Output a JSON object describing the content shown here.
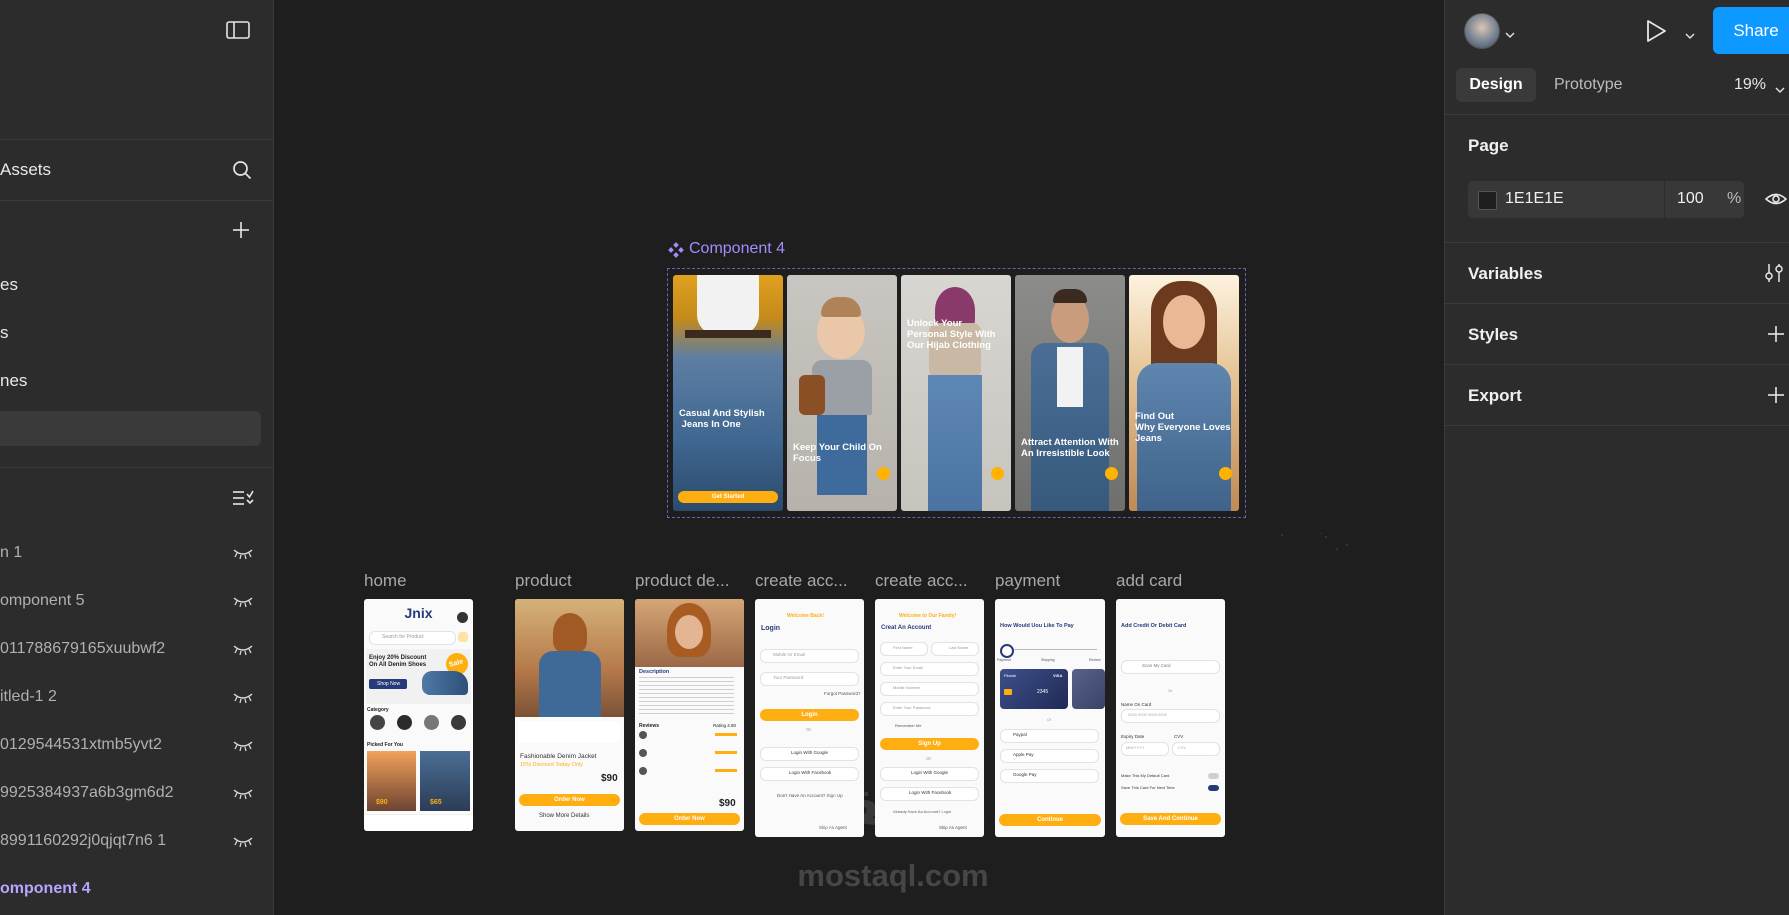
{
  "left_panel": {
    "assets_label": "Assets",
    "pages": [
      "es",
      "s",
      "nes"
    ],
    "layers": [
      {
        "name": "n  1",
        "active": false
      },
      {
        "name": "omponent 5",
        "active": false
      },
      {
        "name": "011788679165xuubwf2",
        "active": false
      },
      {
        "name": "itled-1 2",
        "active": false
      },
      {
        "name": "0129544531xtmb5yvt2",
        "active": false
      },
      {
        "name": "9925384937a6b3gm6d2",
        "active": false
      },
      {
        "name": "8991160292j0qjqt7n6 1",
        "active": false
      },
      {
        "name": "omponent 4",
        "active": true
      }
    ]
  },
  "right_panel": {
    "share_label": "Share",
    "tabs": {
      "design": "Design",
      "prototype": "Prototype"
    },
    "zoom": "19%",
    "page_section": {
      "title": "Page",
      "color_hex": "1E1E1E",
      "opacity": "100",
      "percent": "%"
    },
    "sections": {
      "variables": "Variables",
      "styles": "Styles",
      "export": "Export"
    }
  },
  "canvas": {
    "component_label": "Component 4",
    "onboarding": [
      {
        "text": "Casual And Stylish\n Jeans In One",
        "button": "Get Started"
      },
      {
        "text": "Keep Your Child On\nFocus"
      },
      {
        "text": "Unlock Your\nPersonal Style With\nOur Hijab Clothing"
      },
      {
        "text": "Attract Attention With\nAn Irresistible Look"
      },
      {
        "text": "Find Out\nWhy Everyone Loves\nJeans"
      }
    ],
    "frames": [
      {
        "label": "home"
      },
      {
        "label": "product"
      },
      {
        "label": "product de..."
      },
      {
        "label": "create acc..."
      },
      {
        "label": "create acc..."
      },
      {
        "label": "payment"
      },
      {
        "label": "add card"
      }
    ],
    "home": {
      "brand": "Jnix",
      "search": "Search for Product",
      "promo": "Enjoy 20% Discount\nOn All Denim Shoes",
      "sale": "Sale",
      "shop_now": "Shop Now",
      "categories": "Category",
      "picked": "Picked For You",
      "price1": "$90",
      "price2": "$65"
    },
    "product": {
      "title": "Fashionable Denim Jacket",
      "discount": "15% Discount Today Only",
      "price": "$90",
      "order": "Order Now",
      "more": "Show More Details"
    },
    "product_detail": {
      "description": "Description",
      "reviews": "Reviews",
      "rating": "Rating  4.80",
      "price": "$90",
      "order": "Order Now"
    },
    "login": {
      "welcome": "Welcome Back!",
      "title": "Login",
      "mobile": "Mobile Or Email",
      "password": "Your Password",
      "forgot": "Forgot Password?",
      "button": "Login",
      "or": "Or",
      "google": "Login With Google",
      "facebook": "Login With Facebook",
      "no_account": "Don't Have An Account? Sign Up",
      "skip": "Skip As Agent"
    },
    "signup": {
      "welcome": "Welcome to Our Family!",
      "title": "Creat An Account",
      "first": "First Name",
      "last": "Last Name",
      "email": "Enter Your Email",
      "mobile": "Mobile Number",
      "password": "Enter Your Password",
      "remember": "Remember Me",
      "button": "Sign Up",
      "or": "Or",
      "google": "Login With Google",
      "facebook": "Login With Facebook",
      "have": "Already Have An Account? Login",
      "skip": "Skip As Agent"
    },
    "payment": {
      "title": "How Would Uou Like To Pay",
      "steps": [
        "Payment",
        "Shipping",
        "Review"
      ],
      "card_bank": "Fibank",
      "card_brand": "VISA",
      "card_num": "2345",
      "or": "Or",
      "paypal": "Paypal",
      "apple": "Apple Pay",
      "google": "Google Pay",
      "continue": "Continue"
    },
    "add_card": {
      "title": "Add Credit Or Debit Card",
      "scan": "Scan My Card",
      "or": "Or",
      "name_label": "Name On Card",
      "card_number": "0000 0000 0000 0000",
      "expiry": "Expiry Date",
      "expiry_ph": "MM/YYYY",
      "cvv": "CVV",
      "cvv_ph": "CVV",
      "default": "Make This My Default Card",
      "save_next": "Save This Card For Next Time",
      "save": "Save And Continue"
    },
    "watermark": {
      "arabic": "مستقل",
      "latin": "mostaql.com"
    }
  },
  "colors": {
    "accent_blue": "#0d99ff",
    "component_purple": "#a58bff",
    "orange": "#ffae12",
    "canvas_bg": "#1e1e1e"
  }
}
